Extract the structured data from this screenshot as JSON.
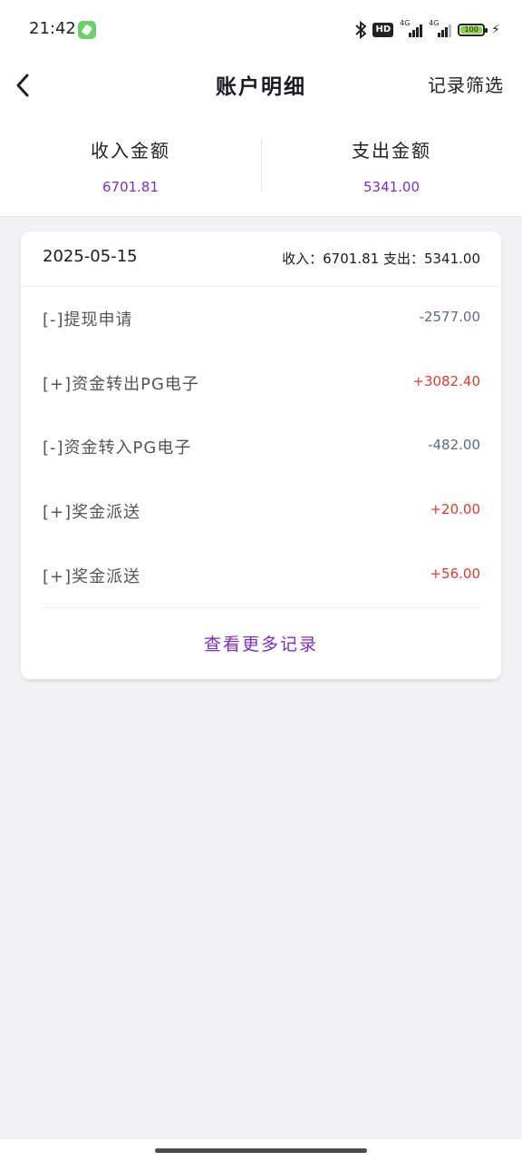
{
  "status_bar": {
    "time": "21:42",
    "network_tag_1": "4G",
    "network_tag_2": "4G",
    "hd_label": "HD",
    "battery_level": "100",
    "icons": [
      "app-badge-icon",
      "bluetooth-icon",
      "hd-icon",
      "signal-icon",
      "signal-icon",
      "battery-icon",
      "charging-icon"
    ]
  },
  "header": {
    "title": "账户明细",
    "back_icon": "chevron-left-icon",
    "filter_label": "记录筛选"
  },
  "summary": {
    "income_label": "收入金额",
    "income_value": "6701.81",
    "expense_label": "支出金额",
    "expense_value": "5341.00"
  },
  "day_card": {
    "date": "2025-05-15",
    "income_label": "收入：",
    "income_value": "6701.81",
    "expense_label": "支出：",
    "expense_value": "5341.00",
    "records": [
      {
        "label": "[-]提现申请",
        "amount": "-2577.00",
        "sign": "negative"
      },
      {
        "label": "[+]资金转出PG电子",
        "amount": "+3082.40",
        "sign": "positive"
      },
      {
        "label": "[-]资金转入PG电子",
        "amount": "-482.00",
        "sign": "negative"
      },
      {
        "label": "[+]奖金派送",
        "amount": "+20.00",
        "sign": "positive"
      },
      {
        "label": "[+]奖金派送",
        "amount": "+56.00",
        "sign": "positive"
      }
    ],
    "more_label": "查看更多记录"
  },
  "colors": {
    "accent": "#7b2fc6",
    "positive": "#e23b2e",
    "negative": "#5c6a86",
    "background": "#f2f2f4"
  }
}
